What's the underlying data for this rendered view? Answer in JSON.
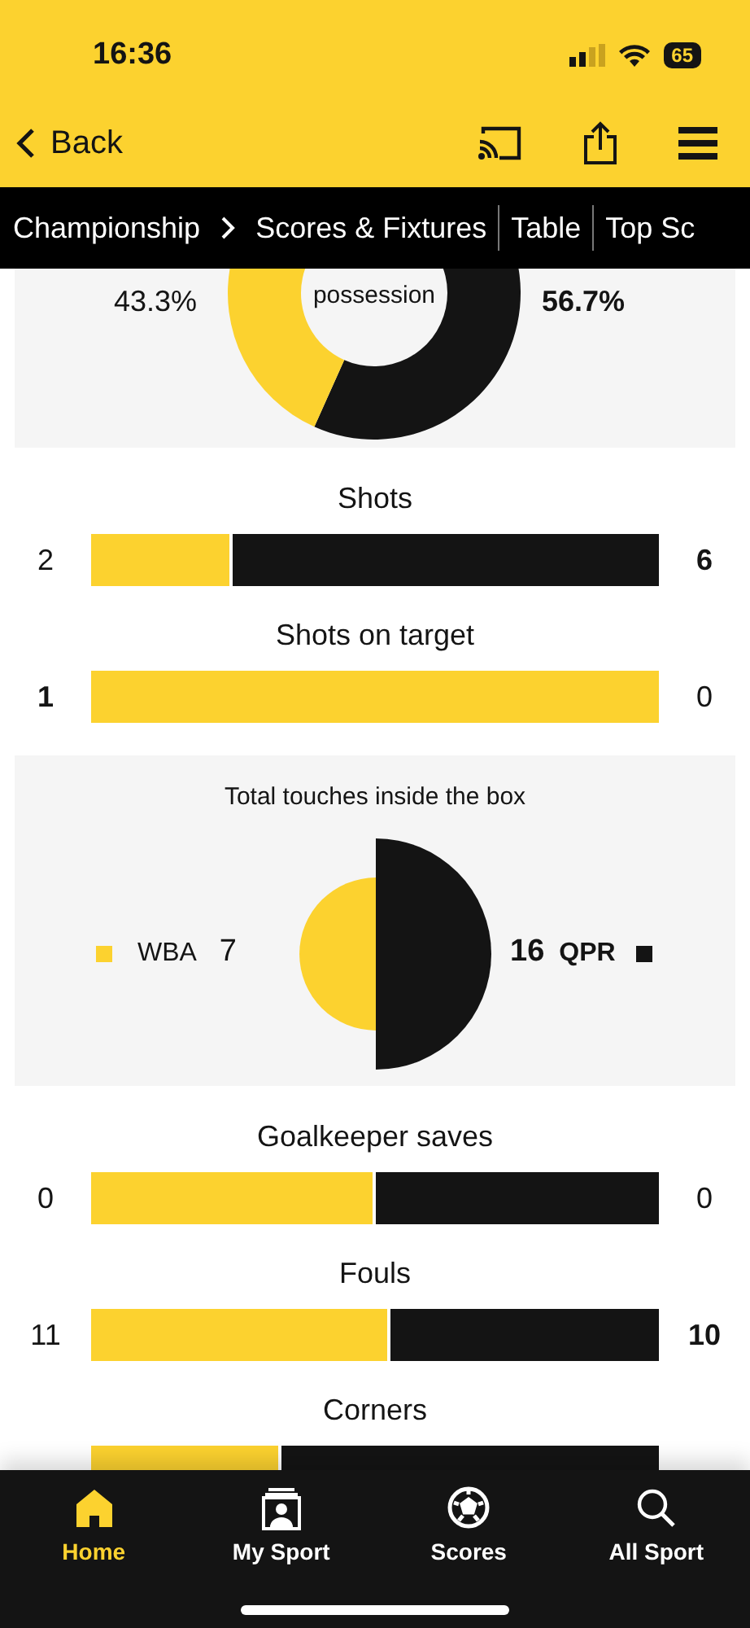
{
  "status_bar": {
    "time": "16:36",
    "battery": "65"
  },
  "app_bar": {
    "back": "Back"
  },
  "breadcrumb": [
    {
      "label": "Championship",
      "kind": "parent"
    },
    {
      "label": "Scores & Fixtures",
      "kind": "link"
    },
    {
      "label": "Table",
      "kind": "link"
    },
    {
      "label": "Top Sc",
      "kind": "link"
    }
  ],
  "possession": {
    "title": "possession",
    "home": "43.3%",
    "away": "56.7%",
    "chart_data": {
      "type": "donut",
      "values": [
        43.3,
        56.7
      ],
      "colors": [
        "#fcd22f",
        "#141414"
      ]
    }
  },
  "stats": [
    {
      "label": "Shots",
      "home": "2",
      "away": "6",
      "level": 0.25,
      "home_bold": false,
      "away_bold": true
    },
    {
      "label": "Shots on target",
      "home": "1",
      "away": "0",
      "level": 1,
      "home_bold": true,
      "away_bold": false
    }
  ],
  "touches": {
    "title": "Total touches inside the box",
    "home": {
      "team": "WBA",
      "value": "7",
      "color": "#fcd22f"
    },
    "away": {
      "team": "QPR",
      "value": "16",
      "color": "#141414"
    }
  },
  "stats_2": [
    {
      "label": "Goalkeeper saves",
      "home": "0",
      "away": "0",
      "level": 0.5,
      "home_bold": false,
      "away_bold": false
    },
    {
      "label": "Fouls",
      "home": "11",
      "away": "10",
      "level": 0.526,
      "home_bold": false,
      "away_bold": true
    },
    {
      "label": "Corners",
      "level": 0.336
    }
  ],
  "tab_bar": [
    {
      "label": "Home",
      "kind": "home",
      "selected": true
    },
    {
      "label": "My Sport",
      "kind": "mysport",
      "selected": false
    },
    {
      "label": "Scores",
      "kind": "scores",
      "selected": false
    },
    {
      "label": "All Sport",
      "kind": "search",
      "selected": false
    }
  ]
}
